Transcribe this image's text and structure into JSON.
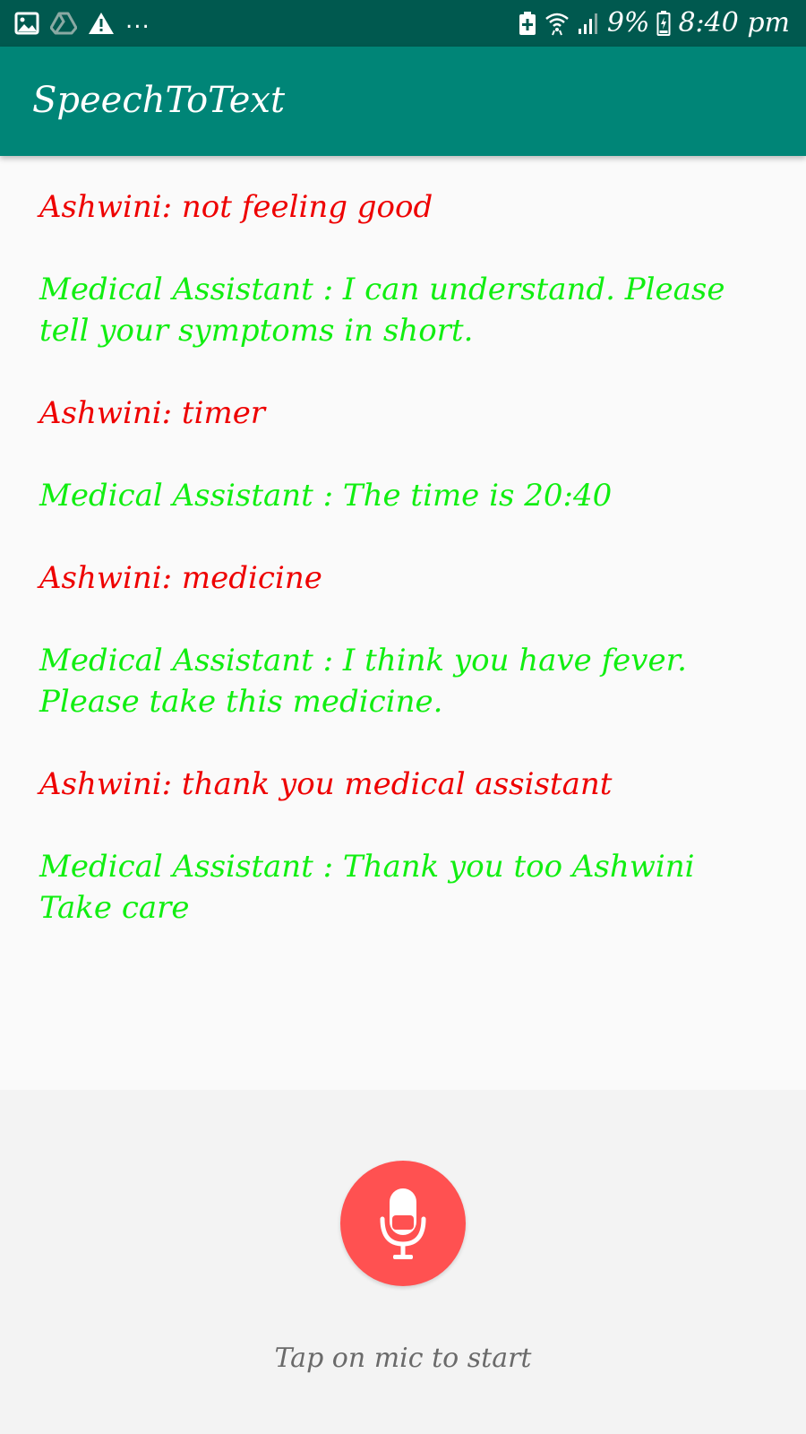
{
  "status_bar": {
    "icons_left": [
      "image-icon",
      "drive-icon",
      "alert-icon",
      "more-dots"
    ],
    "more_text": "...",
    "icons_right": [
      "battery-saver-icon",
      "wifi-icon",
      "signal-icon"
    ],
    "battery_percent": "9%",
    "time": "8:40 pm"
  },
  "app_bar": {
    "title": "SpeechToText",
    "color": "#008577"
  },
  "chat": {
    "messages": [
      {
        "role": "user",
        "text": "Ashwini: not feeling good"
      },
      {
        "role": "assistant",
        "text": "Medical Assistant : I can understand. Please tell your symptoms in short."
      },
      {
        "role": "user",
        "text": "Ashwini: timer"
      },
      {
        "role": "assistant",
        "text": "Medical Assistant : The time is 20:40"
      },
      {
        "role": "user",
        "text": "Ashwini: medicine"
      },
      {
        "role": "assistant",
        "text": "Medical Assistant : I think you have fever. Please take this medicine."
      },
      {
        "role": "user",
        "text": "Ashwini: thank you medical assistant"
      },
      {
        "role": "assistant",
        "text": "Medical Assistant : Thank you too Ashwini Take care"
      }
    ],
    "user_color": "#ee0000",
    "assistant_color": "#11ee11"
  },
  "mic": {
    "icon": "microphone-icon",
    "color": "#ff5151"
  },
  "hint": {
    "text": "Tap on mic to start"
  }
}
